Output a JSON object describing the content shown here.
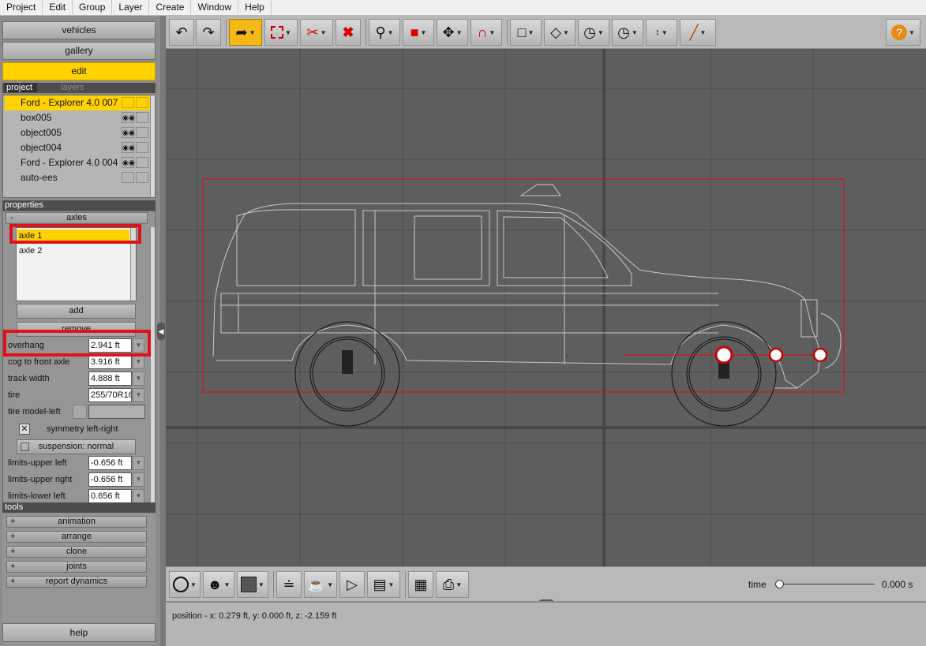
{
  "menu": [
    "Project",
    "Edit",
    "Group",
    "Layer",
    "Create",
    "Window",
    "Help"
  ],
  "nav": {
    "vehicles": "vehicles",
    "gallery": "gallery",
    "edit": "edit",
    "help": "help"
  },
  "project_panel": {
    "tab_project": "project",
    "tab_layers": "layers",
    "items": [
      {
        "label": "Ford - Explorer 4.0 007"
      },
      {
        "label": "box005"
      },
      {
        "label": "object005"
      },
      {
        "label": "object004"
      },
      {
        "label": "Ford - Explorer 4.0 004"
      },
      {
        "label": "auto-ees"
      }
    ]
  },
  "properties": {
    "header": "properties",
    "group": "axles",
    "group_sign": "-",
    "axles": [
      "axle 1",
      "axle 2"
    ],
    "add_label": "add",
    "remove_label": "remove",
    "fields": {
      "overhang": {
        "label": "overhang",
        "value": "2.941 ft"
      },
      "cog": {
        "label": "cog to front axle",
        "value": "3.916 ft"
      },
      "track": {
        "label": "track width",
        "value": "4.888 ft"
      },
      "tire": {
        "label": "tire",
        "value": "255/70R16"
      },
      "tire_model_left": {
        "label": "tire model-left",
        "value": ""
      },
      "limits_upper_left": {
        "label": "limits-upper left",
        "value": "-0.656 ft"
      },
      "limits_upper_right": {
        "label": "limits-upper right",
        "value": "-0.656 ft"
      },
      "limits_lower_left": {
        "label": "limits-lower left",
        "value": "0.656 ft"
      }
    },
    "symmetry_label": "symmetry left-right",
    "suspension_label": "suspension: normal"
  },
  "tools": {
    "header": "tools",
    "items": [
      "animation",
      "arrange",
      "clone",
      "joints",
      "report dynamics"
    ],
    "sign": "+"
  },
  "timeline": {
    "label": "time",
    "value": "0.000 s",
    "progress": 0
  },
  "status": {
    "text": "position - x: 0.279 ft, y: 0.000 ft, z: -2.159 ft"
  },
  "icons": {
    "undo": "undo-icon",
    "redo": "redo-icon",
    "select": "select-arrow-icon",
    "box_select": "box-select-icon",
    "cut": "cut-icon",
    "delete": "delete-x-icon",
    "zoom": "magnifier-icon",
    "cube": "red-cube-icon",
    "move": "move-icon",
    "magnet": "magnet-icon",
    "view_cube": "view-cube-icon",
    "plane": "plane-icon",
    "gauge1": "gauge-icon",
    "gauge2": "gauge-icon",
    "measure": "measure-1m-icon",
    "brush": "brush-icon",
    "help": "help-icon"
  },
  "colors": {
    "accent": "#ffd200",
    "highlight_red": "#e0121c",
    "viewport": "#5c5c5c"
  }
}
